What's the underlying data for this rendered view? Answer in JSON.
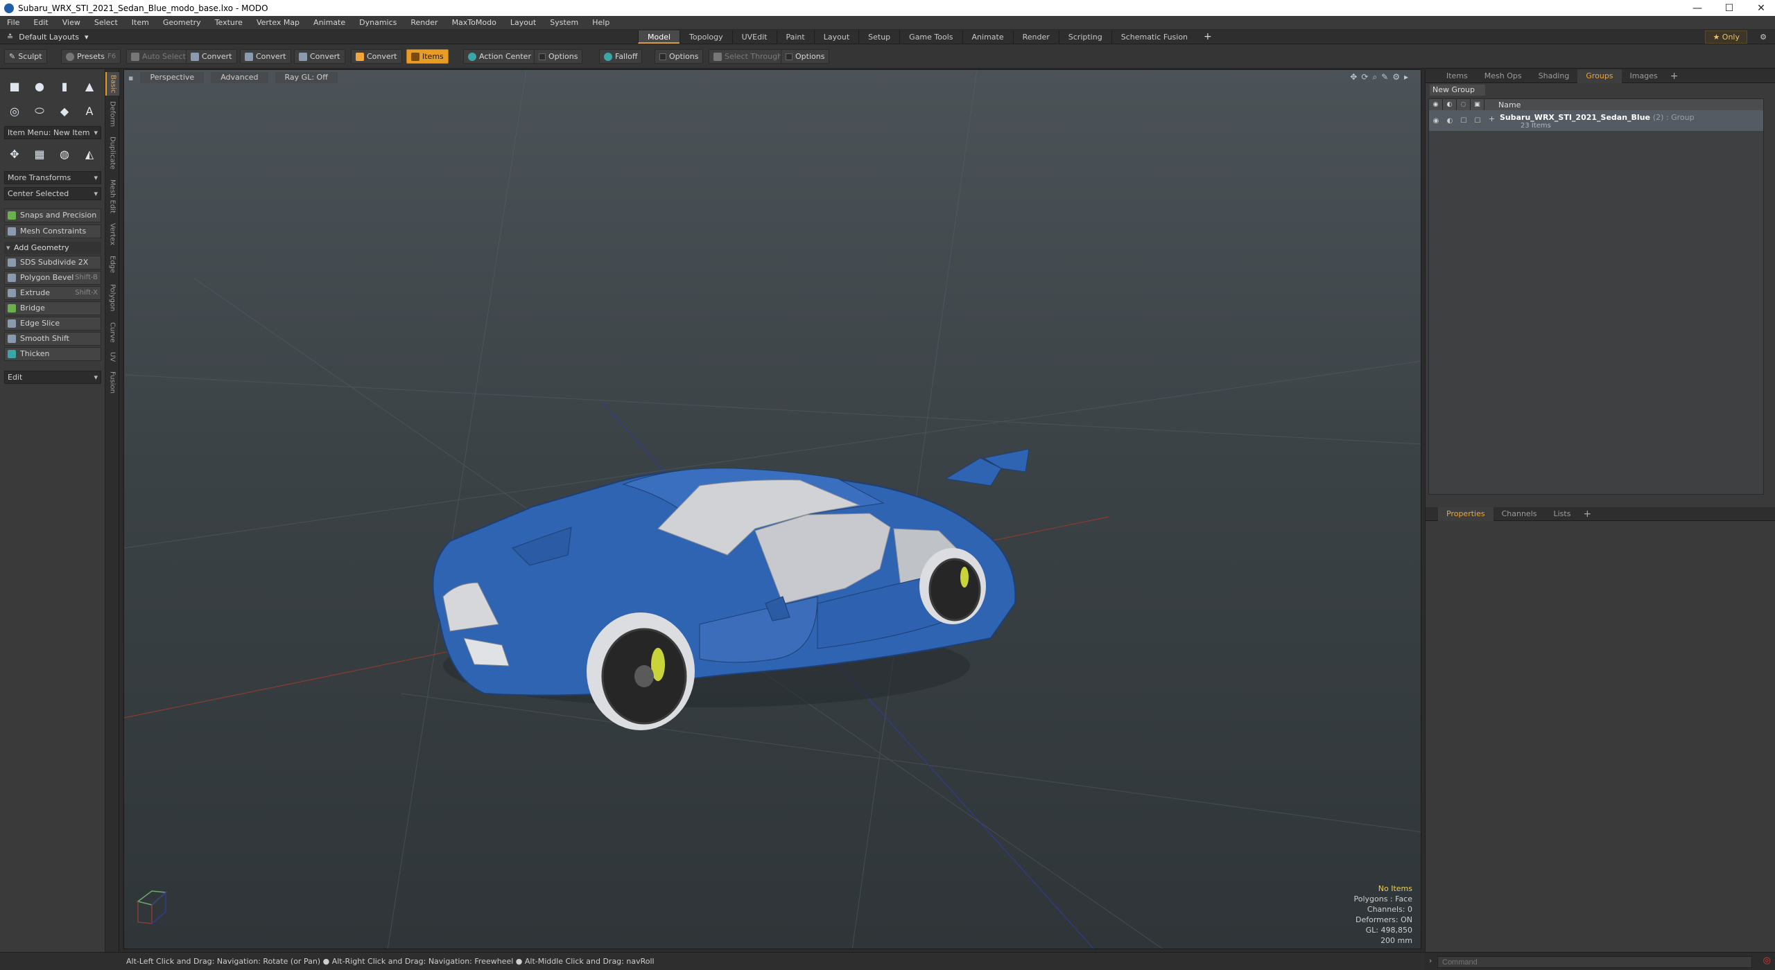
{
  "window": {
    "title": "Subaru_WRX_STI_2021_Sedan_Blue_modo_base.lxo - MODO"
  },
  "menu": [
    "File",
    "Edit",
    "View",
    "Select",
    "Item",
    "Geometry",
    "Texture",
    "Vertex Map",
    "Animate",
    "Dynamics",
    "Render",
    "MaxToModo",
    "Layout",
    "System",
    "Help"
  ],
  "modebar": {
    "layouts_label": "Default Layouts",
    "tabs": [
      "Model",
      "Topology",
      "UVEdit",
      "Paint",
      "Layout",
      "Setup",
      "Game Tools",
      "Animate",
      "Render",
      "Scripting",
      "Schematic Fusion"
    ],
    "active_tab": "Model",
    "only_label": "Only"
  },
  "toolbar": {
    "sculpt": "Sculpt",
    "presets": "Presets",
    "presets_key": "F6",
    "auto_select": "Auto Select",
    "convert1": "Convert",
    "convert2": "Convert",
    "convert3": "Convert",
    "convert4": "Convert",
    "items": "Items",
    "action_center": "Action Center",
    "options1": "Options",
    "falloff": "Falloff",
    "options2": "Options",
    "select_through": "Select Through",
    "options3": "Options"
  },
  "left": {
    "item_menu": "Item Menu: New Item",
    "more_transforms": "More Transforms",
    "center_selected": "Center Selected",
    "snaps": "Snaps and Precision",
    "mesh_constraints": "Mesh Constraints",
    "add_geometry": "Add Geometry",
    "tools": [
      {
        "label": "SDS Subdivide 2X",
        "key": ""
      },
      {
        "label": "Polygon Bevel",
        "key": "Shift-B"
      },
      {
        "label": "Extrude",
        "key": "Shift-X"
      },
      {
        "label": "Bridge",
        "key": ""
      },
      {
        "label": "Edge Slice",
        "key": ""
      },
      {
        "label": "Smooth Shift",
        "key": ""
      },
      {
        "label": "Thicken",
        "key": ""
      }
    ],
    "edit": "Edit",
    "sidetabs": [
      "Basic",
      "Deform",
      "Duplicate",
      "Mesh Edit",
      "Vertex",
      "Edge",
      "Polygon",
      "Curve",
      "UV",
      "Fusion"
    ]
  },
  "viewport": {
    "perspective": "Perspective",
    "advanced": "Advanced",
    "raygl": "Ray GL: Off",
    "info": {
      "items": "No Items",
      "polygons": "Polygons : Face",
      "channels": "Channels: 0",
      "deformers": "Deformers: ON",
      "gl": "GL: 498,850",
      "scale": "200 mm"
    },
    "colors": {
      "car_body": "#2f64b3",
      "glass": "#c9cbcf",
      "wheel": "#2b2b2b",
      "caliper": "#c8d43a"
    }
  },
  "right": {
    "tabs_top": [
      "Items",
      "Mesh Ops",
      "Shading",
      "Groups",
      "Images"
    ],
    "active_top": "Groups",
    "new_group": "New Group",
    "col_name": "Name",
    "group": {
      "name": "Subaru_WRX_STI_2021_Sedan_Blue",
      "meta": "(2) : Group",
      "count": "23 Items"
    },
    "tabs_bottom": [
      "Properties",
      "Channels",
      "Lists"
    ],
    "active_bottom": "Properties"
  },
  "command": {
    "placeholder": "Command"
  },
  "status": "Alt-Left Click and Drag: Navigation: Rotate (or Pan) ● Alt-Right Click and Drag: Navigation: Freewheel ● Alt-Middle Click and Drag: navRoll"
}
